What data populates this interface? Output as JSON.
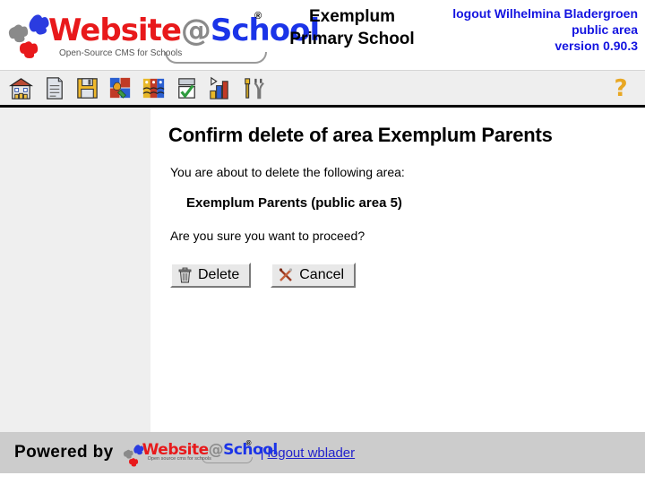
{
  "header": {
    "logo": {
      "word_part1": "Website",
      "word_at": "@",
      "word_part2": "School",
      "registered": "®",
      "tagline": "Open-Source CMS for Schools"
    },
    "school_name_line1": "Exemplum",
    "school_name_line2": "Primary School",
    "account": {
      "logout_line": "logout Wilhelmina Bladergroen",
      "area_line": "public area",
      "version_line": "version 0.90.3"
    },
    "colors": {
      "logo_red": "#e8191b",
      "logo_blue": "#1b34e8",
      "logo_grey": "#8a8a8a",
      "account_text": "#1414e0"
    }
  },
  "toolbar": {
    "items": [
      {
        "name": "school-icon",
        "title": "School"
      },
      {
        "name": "page-icon",
        "title": "Page"
      },
      {
        "name": "save-floppy-icon",
        "title": "Save"
      },
      {
        "name": "modules-puzzle-icon",
        "title": "Modules"
      },
      {
        "name": "users-faces-icon",
        "title": "Users"
      },
      {
        "name": "tasks-checklist-icon",
        "title": "Tasks"
      },
      {
        "name": "statistics-bar-chart-icon",
        "title": "Statistics"
      },
      {
        "name": "tools-wrench-icon",
        "title": "Tools"
      }
    ],
    "help": {
      "name": "help-question-icon",
      "label": "?",
      "color": "#e8a723"
    }
  },
  "main": {
    "title": "Confirm delete of area Exemplum Parents",
    "intro": "You are about to delete the following area:",
    "area_label": "Exemplum Parents (public area 5)",
    "question": "Are you sure you want to proceed?",
    "buttons": {
      "delete": {
        "label": "Delete",
        "icon": "trash-can-icon"
      },
      "cancel": {
        "label": "Cancel",
        "icon": "crossed-tools-icon"
      }
    }
  },
  "footer": {
    "powered_by": "Powered by",
    "logo": {
      "word_part1": "Website",
      "word_at": "@",
      "word_part2": "School",
      "registered": "®",
      "tagline": "Open source cms for schools"
    },
    "separator": "|",
    "logout_link": "logout wblader"
  }
}
